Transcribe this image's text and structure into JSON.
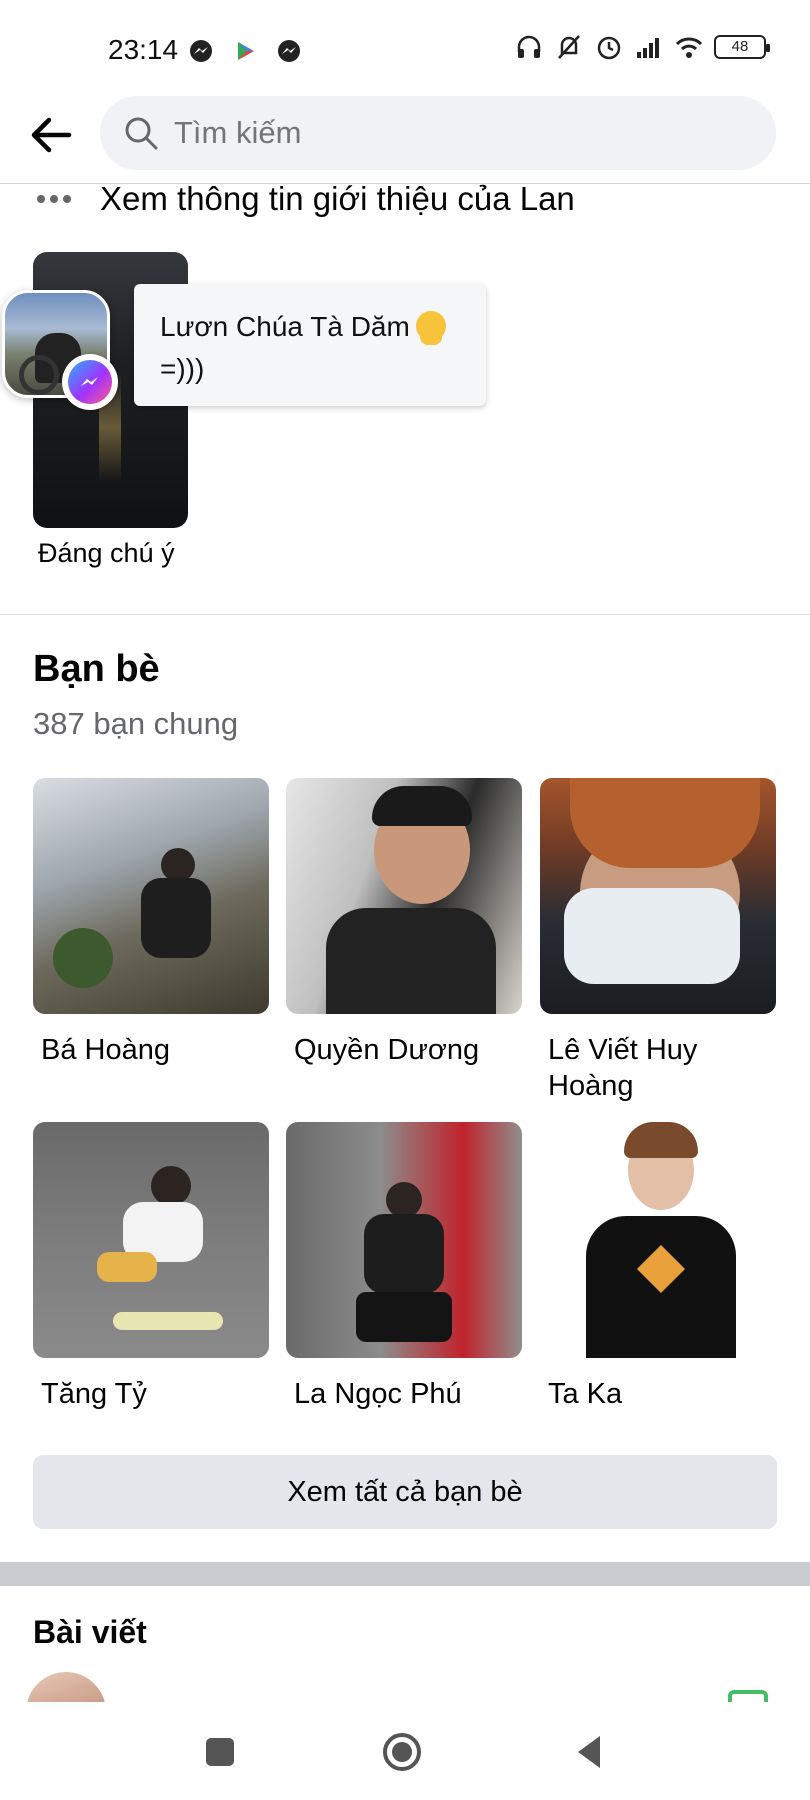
{
  "status_bar": {
    "time": "23:14",
    "battery": "48",
    "left_icons": [
      "messenger-icon",
      "play-store-icon",
      "messenger-icon"
    ],
    "right_icons": [
      "headphones-icon",
      "bell-muted-icon",
      "alarm-icon",
      "signal-icon",
      "wifi-icon",
      "battery-icon"
    ]
  },
  "topbar": {
    "search_placeholder": "Tìm kiếm"
  },
  "about": {
    "text": "Xem thông tin giới thiệu của Lan"
  },
  "highlight": {
    "label": "Đáng chú ý"
  },
  "chat_head": {
    "line1": "Lươn Chúa Tà Dăm",
    "line2": "=)))"
  },
  "friends": {
    "title": "Bạn bè",
    "count": "387 bạn chung",
    "items": [
      {
        "name": "Bá Hoàng"
      },
      {
        "name": "Quyền Dương"
      },
      {
        "name": "Lê Viết Huy Hoàng"
      },
      {
        "name": "Tăng Tỷ"
      },
      {
        "name": "La Ngọc Phú"
      },
      {
        "name": "Ta Ka"
      }
    ],
    "see_all": "Xem tất cả bạn bè"
  },
  "posts": {
    "title": "Bài viết"
  },
  "colors": {
    "accent": "#1877f2",
    "secondary_text": "#65676b",
    "button_bg": "#e4e6eb",
    "photo_green": "#45bd62"
  }
}
